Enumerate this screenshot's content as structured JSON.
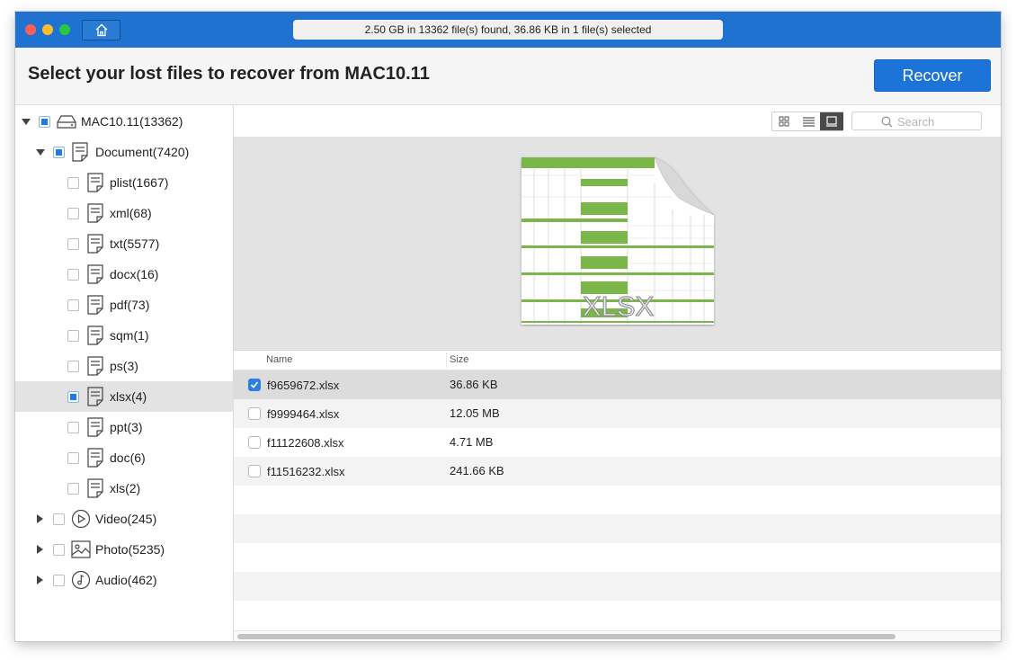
{
  "titlebar": {
    "status": "2.50 GB in 13362 file(s) found, 36.86 KB in 1 file(s) selected"
  },
  "header": {
    "title": "Select your lost files to recover from MAC10.11",
    "recover_label": "Recover"
  },
  "sidebar": {
    "items": [
      {
        "label": "MAC10.11(13362)",
        "icon": "drive-icon",
        "expanded": true,
        "checkbox": "partial"
      },
      {
        "label": "Document(7420)",
        "icon": "document-icon",
        "expanded": true,
        "checkbox": "partial"
      },
      {
        "label": "plist(1667)",
        "icon": "document-icon",
        "checkbox": "unchecked"
      },
      {
        "label": "xml(68)",
        "icon": "document-icon",
        "checkbox": "unchecked"
      },
      {
        "label": "txt(5577)",
        "icon": "document-icon",
        "checkbox": "unchecked"
      },
      {
        "label": "docx(16)",
        "icon": "document-icon",
        "checkbox": "unchecked"
      },
      {
        "label": "pdf(73)",
        "icon": "document-icon",
        "checkbox": "unchecked"
      },
      {
        "label": "sqm(1)",
        "icon": "document-icon",
        "checkbox": "unchecked"
      },
      {
        "label": "ps(3)",
        "icon": "document-icon",
        "checkbox": "unchecked"
      },
      {
        "label": "xlsx(4)",
        "icon": "document-icon",
        "checkbox": "partial",
        "selected": true
      },
      {
        "label": "ppt(3)",
        "icon": "document-icon",
        "checkbox": "unchecked"
      },
      {
        "label": "doc(6)",
        "icon": "document-icon",
        "checkbox": "unchecked"
      },
      {
        "label": "xls(2)",
        "icon": "document-icon",
        "checkbox": "unchecked"
      },
      {
        "label": "Video(245)",
        "icon": "video-icon",
        "expanded": false,
        "checkbox": "unchecked"
      },
      {
        "label": "Photo(5235)",
        "icon": "photo-icon",
        "expanded": false,
        "checkbox": "unchecked"
      },
      {
        "label": "Audio(462)",
        "icon": "audio-icon",
        "expanded": false,
        "checkbox": "unchecked"
      }
    ]
  },
  "toolbar": {
    "search_placeholder": "Search",
    "active_view": "preview"
  },
  "preview": {
    "file_type": "XLSX"
  },
  "table": {
    "columns": [
      "Name",
      "Size"
    ],
    "rows": [
      {
        "name": "f9659672.xlsx",
        "size": "36.86 KB",
        "checked": true
      },
      {
        "name": "f9999464.xlsx",
        "size": "12.05 MB",
        "checked": false
      },
      {
        "name": "f11122608.xlsx",
        "size": "4.71 MB",
        "checked": false
      },
      {
        "name": "f11516232.xlsx",
        "size": "241.66 KB",
        "checked": false
      }
    ]
  },
  "colors": {
    "titlebar": "#1f72cf",
    "accent": "#1c74d8",
    "spreadsheet_green": "#7ab648"
  }
}
